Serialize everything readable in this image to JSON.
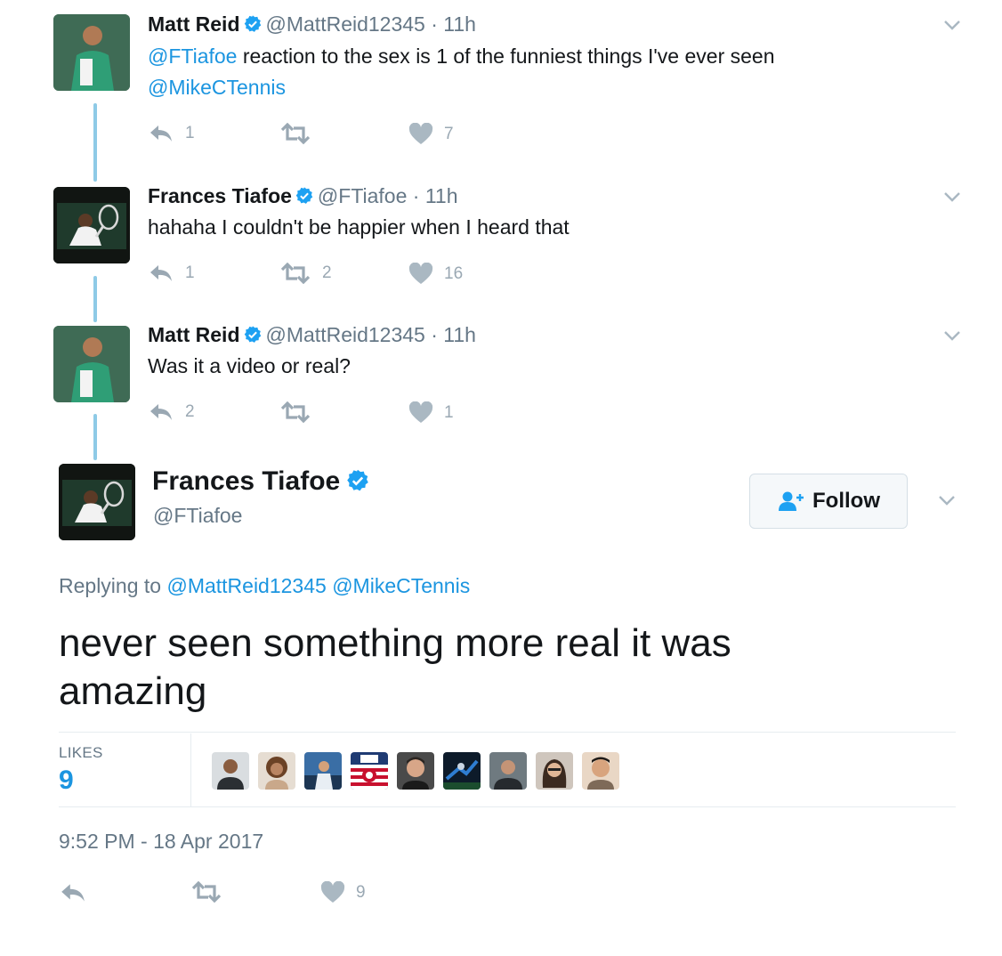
{
  "colors": {
    "link": "#1b95e0",
    "verified": "#1da1f2",
    "muted": "#657786",
    "thread_line": "#8ecae6",
    "action_icon": "#9aa8b3"
  },
  "thread": [
    {
      "name": "Matt Reid",
      "handle": "@MattReid12345",
      "time": "· 11h",
      "text_link_1": "@FTiafoe",
      "text_body": " reaction to the sex is 1 of the funniest things I've ever seen",
      "text_link_2": "@MikeCTennis",
      "replies": "1",
      "retweets": "",
      "likes": "7",
      "avatar_icon": "matt-reid-photo"
    },
    {
      "name": "Frances Tiafoe",
      "handle": "@FTiafoe",
      "time": "· 11h",
      "text_body": "hahaha I couldn't be happier when I heard that",
      "replies": "1",
      "retweets": "2",
      "likes": "16",
      "avatar_icon": "frances-tiafoe-photo"
    },
    {
      "name": "Matt Reid",
      "handle": "@MattReid12345",
      "time": "· 11h",
      "text_body": "Was it a video or real?",
      "replies": "2",
      "retweets": "",
      "likes": "1",
      "avatar_icon": "matt-reid-photo"
    }
  ],
  "main": {
    "name": "Frances Tiafoe",
    "handle": "@FTiafoe",
    "follow_label": "Follow",
    "replying_prefix": "Replying to",
    "replying_to_1": "@MattReid12345",
    "replying_to_2": "@MikeCTennis",
    "text": "never seen something more real it was amazing",
    "likes_label": "LIKES",
    "likes_count": "9",
    "liker_avatars": 9,
    "timestamp": "9:52 PM - 18 Apr 2017",
    "footer_likes": "9"
  }
}
